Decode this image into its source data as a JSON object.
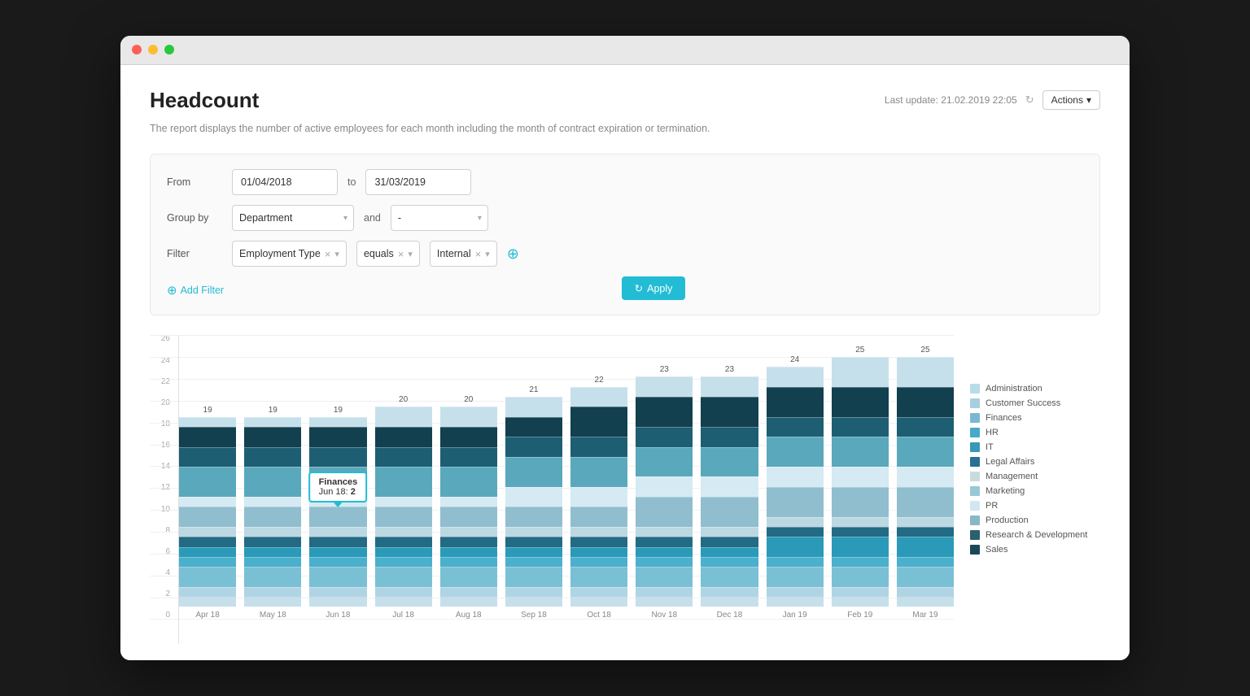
{
  "window": {
    "title": "Headcount"
  },
  "header": {
    "title": "Headcount",
    "last_update_label": "Last update: 21.02.2019 22:05",
    "actions_label": "Actions",
    "description": "The report displays the number of active employees for each month including the month of contract expiration or termination."
  },
  "filters": {
    "from_label": "From",
    "from_value": "01/04/2018",
    "to_label": "to",
    "to_value": "31/03/2019",
    "group_by_label": "Group by",
    "group_by_value": "Department",
    "group_by_and_label": "and",
    "group_by_second_value": "-",
    "filter_label": "Filter",
    "filter_field": "Employment Type",
    "filter_operator": "equals",
    "filter_value": "Internal",
    "add_filter_label": "Add Filter",
    "apply_label": "Apply"
  },
  "chart": {
    "y_labels": [
      "26",
      "24",
      "22",
      "20",
      "18",
      "16",
      "14",
      "12",
      "10",
      "8",
      "6",
      "4",
      "2",
      "0"
    ],
    "tooltip": {
      "title": "Finances",
      "subtitle": "Jun 18:",
      "value": "2"
    },
    "bars": [
      {
        "month": "Apr 18",
        "total": 19,
        "segments": [
          1,
          1,
          2,
          1,
          1,
          1,
          1,
          2,
          1,
          3,
          2,
          2,
          1
        ]
      },
      {
        "month": "May 18",
        "total": 19,
        "segments": [
          1,
          1,
          2,
          1,
          1,
          1,
          1,
          2,
          1,
          3,
          2,
          2,
          1
        ]
      },
      {
        "month": "Jun 18",
        "total": 19,
        "segments": [
          1,
          1,
          2,
          1,
          1,
          1,
          1,
          2,
          1,
          3,
          2,
          2,
          1
        ]
      },
      {
        "month": "Jul 18",
        "total": 20,
        "segments": [
          1,
          1,
          2,
          1,
          1,
          1,
          1,
          2,
          1,
          3,
          2,
          2,
          2
        ]
      },
      {
        "month": "Aug 18",
        "total": 20,
        "segments": [
          1,
          1,
          2,
          1,
          1,
          1,
          1,
          2,
          1,
          3,
          2,
          2,
          2
        ]
      },
      {
        "month": "Sep 18",
        "total": 21,
        "segments": [
          1,
          1,
          2,
          1,
          1,
          1,
          1,
          2,
          2,
          3,
          2,
          2,
          2
        ]
      },
      {
        "month": "Oct 18",
        "total": 22,
        "segments": [
          1,
          1,
          2,
          1,
          1,
          1,
          1,
          2,
          2,
          3,
          2,
          3,
          2
        ]
      },
      {
        "month": "Nov 18",
        "total": 23,
        "segments": [
          1,
          1,
          2,
          1,
          1,
          1,
          1,
          3,
          2,
          3,
          2,
          3,
          2
        ]
      },
      {
        "month": "Dec 18",
        "total": 23,
        "segments": [
          1,
          1,
          2,
          1,
          1,
          1,
          1,
          3,
          2,
          3,
          2,
          3,
          2
        ]
      },
      {
        "month": "Jan 19",
        "total": 24,
        "segments": [
          1,
          1,
          2,
          1,
          2,
          1,
          1,
          3,
          2,
          3,
          2,
          3,
          2
        ]
      },
      {
        "month": "Feb 19",
        "total": 25,
        "segments": [
          1,
          1,
          2,
          1,
          2,
          1,
          1,
          3,
          2,
          3,
          2,
          3,
          3
        ]
      },
      {
        "month": "Mar 19",
        "total": 25,
        "segments": [
          1,
          1,
          2,
          1,
          2,
          1,
          1,
          3,
          2,
          3,
          2,
          3,
          3
        ]
      }
    ],
    "legend": [
      {
        "label": "Administration",
        "color": "#b8dce8"
      },
      {
        "label": "Customer Success",
        "color": "#a8cfe0"
      },
      {
        "label": "Finances",
        "color": "#7ab8d0"
      },
      {
        "label": "HR",
        "color": "#4aa8c8"
      },
      {
        "label": "IT",
        "color": "#3898b8"
      },
      {
        "label": "Legal Affairs",
        "color": "#2a7090"
      },
      {
        "label": "Management",
        "color": "#c8dce0"
      },
      {
        "label": "Marketing",
        "color": "#98c8d8"
      },
      {
        "label": "PR",
        "color": "#d0e8f0"
      },
      {
        "label": "Production",
        "color": "#88b8c8"
      },
      {
        "label": "Research & Development",
        "color": "#2a6070"
      },
      {
        "label": "Sales",
        "color": "#1a4858"
      }
    ],
    "segment_colors": [
      "#c8e4ee",
      "#b0d4e4",
      "#7ab8d0",
      "#4aa8c8",
      "#3898b8",
      "#2a7090",
      "#c8dce0",
      "#98c8d8",
      "#d0e8f0",
      "#6ab0c4",
      "#2a6070",
      "#1a4858"
    ]
  }
}
